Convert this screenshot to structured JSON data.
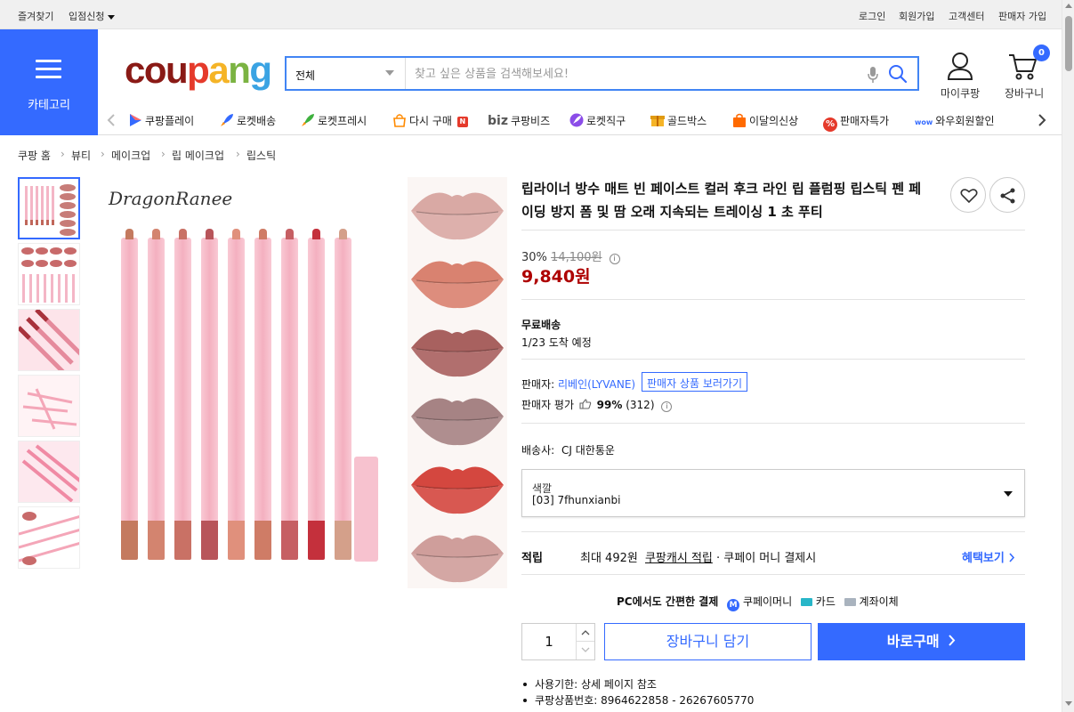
{
  "topbar": {
    "bookmark": "즐겨찾기",
    "partner": "입점신청",
    "login": "로그인",
    "signup": "회원가입",
    "support": "고객센터",
    "seller_signup": "판매자 가입"
  },
  "header": {
    "category_label": "카테고리",
    "logo_letters": [
      "c",
      "o",
      "u",
      "p",
      "a",
      "n",
      "g"
    ],
    "logo_colors": [
      "#8a1a16",
      "#8a1a16",
      "#8a1a16",
      "#e53a2b",
      "#f5b427",
      "#7bb342",
      "#3aa3e3"
    ],
    "search_scope": "전체",
    "search_placeholder": "찾고 싶은 상품을 검색해보세요!",
    "mycoupang": "마이쿠팡",
    "cart": "장바구니",
    "cart_count": "0"
  },
  "strip": {
    "items": [
      "쿠팡플레이",
      "로켓배송",
      "로켓프레시",
      "다시 구매",
      "biz",
      "쿠팡비즈",
      "로켓직구",
      "골드박스",
      "이달의신상",
      "판매자특가",
      "와우회원할인"
    ],
    "new_badge": "N",
    "percent_icon": "%",
    "wow_icon": "wow"
  },
  "breadcrumb": [
    "쿠팡 홈",
    "뷰티",
    "메이크업",
    "립 메이크업",
    "립스틱"
  ],
  "product": {
    "brand_on_image": "DragonRanee",
    "title": "립라이너 방수 매트 빈 페이스트 컬러 후크 라인 립 플럼핑 립스틱 펜 페이딩 방지 폼 및 땀 오래 지속되는 트레이싱 1 초 푸티",
    "discount": "30%",
    "original_price": "14,100원",
    "price": "9,840원",
    "shipping_type": "무료배송",
    "arrival": "1/23 도착 예정",
    "seller_label": "판매자:",
    "seller_name": "리베인(LYVANE)",
    "seller_btn": "판매자 상품 보러가기",
    "rating_label": "판매자 평가",
    "rating_value": "99%",
    "rating_count": "(312)",
    "carrier_label": "배송사:",
    "carrier": "CJ 대한통운",
    "option_label": "색깔",
    "option_value": "[03] 7fhunxianbi",
    "reward_label": "적립",
    "reward_prefix": "최대 492원",
    "reward_link": "쿠팡캐시 적립",
    "reward_suffix": "· 쿠페이 머니 결제시",
    "benefit_link": "혜택보기",
    "pc_pay_label": "PC에서도 간편한 결제",
    "pay_methods": [
      "쿠페이머니",
      "카드",
      "계좌이체"
    ],
    "coupay_icon": "M",
    "quantity": "1",
    "cart_btn": "장바구니 담기",
    "buy_btn": "바로구매",
    "details": [
      "사용기한: 상세 페이지 참조",
      "쿠팡상품번호: 8964622858 - 26267605770"
    ]
  },
  "colors": {
    "accent": "#346aff",
    "price_red": "#ae0000",
    "search_border": "#4285f4"
  }
}
